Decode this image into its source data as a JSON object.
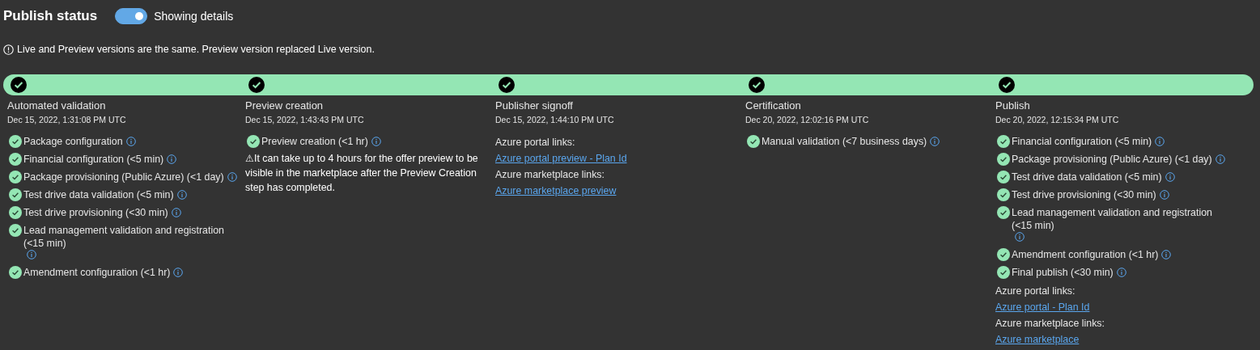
{
  "header": {
    "title": "Publish status",
    "toggle": {
      "on": true,
      "label": "Showing details"
    }
  },
  "notice": "Live and Preview versions are the same. Preview version replaced Live version.",
  "steps": [
    {
      "title": "Automated validation",
      "date": "Dec 15, 2022, 1:31:08 PM UTC",
      "entries": [
        {
          "kind": "task",
          "text": "Package configuration"
        },
        {
          "kind": "task",
          "text": "Financial configuration (<5 min)"
        },
        {
          "kind": "task",
          "text": "Package provisioning (Public Azure) (<1 day)"
        },
        {
          "kind": "task",
          "text": "Test drive data validation (<5 min)"
        },
        {
          "kind": "task",
          "text": "Test drive provisioning (<30 min)"
        },
        {
          "kind": "task",
          "text": "Lead management validation and registration (<15 min)"
        },
        {
          "kind": "task",
          "text": "Amendment configuration (<1 hr)"
        }
      ]
    },
    {
      "title": "Preview creation",
      "date": "Dec 15, 2022, 1:43:43 PM UTC",
      "entries": [
        {
          "kind": "task",
          "text": "Preview creation (<1 hr)"
        },
        {
          "kind": "warning",
          "text": "⚠It can take up to 4 hours for the offer preview to be visible in the marketplace after the Preview Creation step has completed."
        }
      ]
    },
    {
      "title": "Publisher signoff",
      "date": "Dec 15, 2022, 1:44:10 PM UTC",
      "entries": [
        {
          "kind": "heading",
          "text": "Azure portal links:"
        },
        {
          "kind": "link",
          "text": "Azure portal preview - Plan Id"
        },
        {
          "kind": "heading",
          "text": "Azure marketplace links:"
        },
        {
          "kind": "link",
          "text": "Azure marketplace preview"
        }
      ]
    },
    {
      "title": "Certification",
      "date": "Dec 20, 2022, 12:02:16 PM UTC",
      "entries": [
        {
          "kind": "task",
          "text": "Manual validation (<7 business days)"
        }
      ]
    },
    {
      "title": "Publish",
      "date": "Dec 20, 2022, 12:15:34 PM UTC",
      "entries": [
        {
          "kind": "task",
          "text": "Financial configuration (<5 min)"
        },
        {
          "kind": "task",
          "text": "Package provisioning (Public Azure) (<1 day)"
        },
        {
          "kind": "task",
          "text": "Test drive data validation (<5 min)"
        },
        {
          "kind": "task",
          "text": "Test drive provisioning (<30 min)"
        },
        {
          "kind": "task",
          "text": "Lead management validation and registration (<15 min)"
        },
        {
          "kind": "task",
          "text": "Amendment configuration (<1 hr)"
        },
        {
          "kind": "task",
          "text": "Final publish (<30 min)"
        },
        {
          "kind": "heading",
          "text": "Azure portal links:"
        },
        {
          "kind": "link",
          "text": "Azure portal - Plan Id"
        },
        {
          "kind": "heading",
          "text": "Azure marketplace links:"
        },
        {
          "kind": "link",
          "text": "Azure marketplace"
        }
      ]
    }
  ]
}
